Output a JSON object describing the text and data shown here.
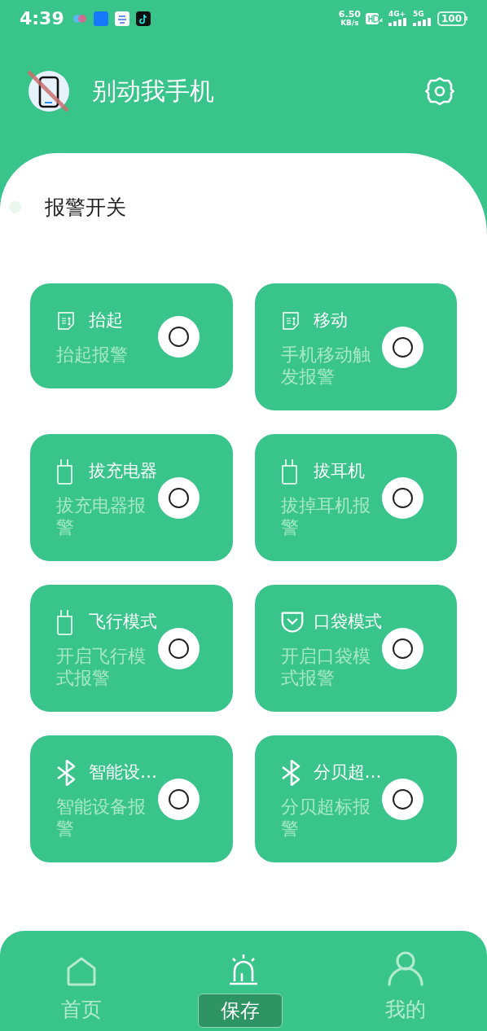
{
  "status_bar": {
    "time": "4:39",
    "net_speed": {
      "value": "6.50",
      "unit": "KB/s"
    },
    "signals": [
      {
        "label": "4G+"
      },
      {
        "label": "5G"
      }
    ],
    "battery": "100"
  },
  "header": {
    "title": "别动我手机"
  },
  "section_title": "报警开关",
  "switches": [
    {
      "title": "抬起",
      "description": "抬起报警",
      "kind": "sensor",
      "on": false
    },
    {
      "title": "移动",
      "description": "手机移动触发报警",
      "kind": "sensor",
      "on": false
    },
    {
      "title": "拔充电器",
      "description": "拔充电器报警",
      "kind": "plug",
      "on": false
    },
    {
      "title": "拔耳机",
      "description": "拔掉耳机报警",
      "kind": "plug",
      "on": false
    },
    {
      "title": "飞行模式",
      "description": "开启飞行模式报警",
      "kind": "plug",
      "on": false
    },
    {
      "title": "口袋模式",
      "description": "开启口袋模式报警",
      "kind": "pocket",
      "on": false
    },
    {
      "title": "智能设…",
      "description": "智能设备报警",
      "kind": "bluetooth",
      "on": false
    },
    {
      "title": "分贝超…",
      "description": "分贝超标报警",
      "kind": "bluetooth",
      "on": false
    }
  ],
  "nav": [
    {
      "label": "首页",
      "kind": "home",
      "selected": false
    },
    {
      "kind": "alarm",
      "selected": true
    },
    {
      "label": "我的",
      "kind": "user",
      "selected": false
    }
  ],
  "toast": "保存"
}
